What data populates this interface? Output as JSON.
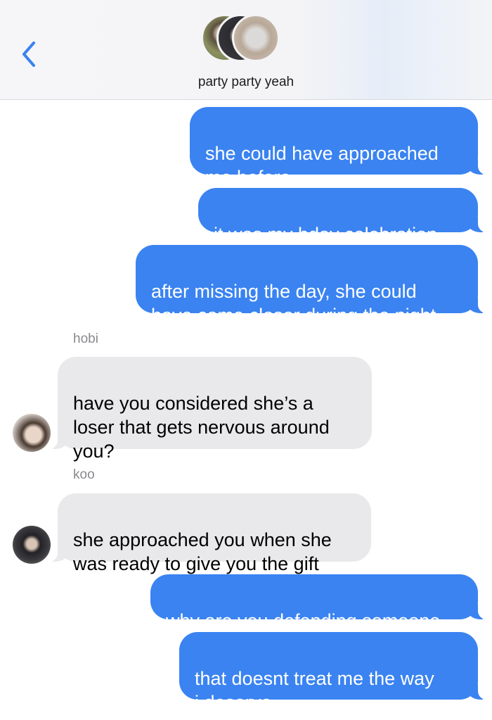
{
  "header": {
    "back_icon": "chevron-left-icon",
    "group_name": "party party yeah",
    "accent": "#3a83f1"
  },
  "messages": [
    {
      "from": "me",
      "text": "she could have approached\nme before"
    },
    {
      "from": "me",
      "text": "it was my bday celebration"
    },
    {
      "from": "me",
      "text": "after missing the day, she could\nhave come closer during the night"
    },
    {
      "from": "hobi",
      "sender": "hobi",
      "text": "have you considered she’s a\nloser that gets nervous around\nyou?"
    },
    {
      "from": "koo",
      "sender": "koo",
      "text": "she approached you when she\nwas ready to give you the gift"
    },
    {
      "from": "me",
      "text": "why are you defending someone"
    },
    {
      "from": "me",
      "text": "that doesnt treat me the way\ni deserve"
    }
  ],
  "colors": {
    "sent_bubble": "#3a83f1",
    "received_bubble": "#e9e9eb"
  }
}
